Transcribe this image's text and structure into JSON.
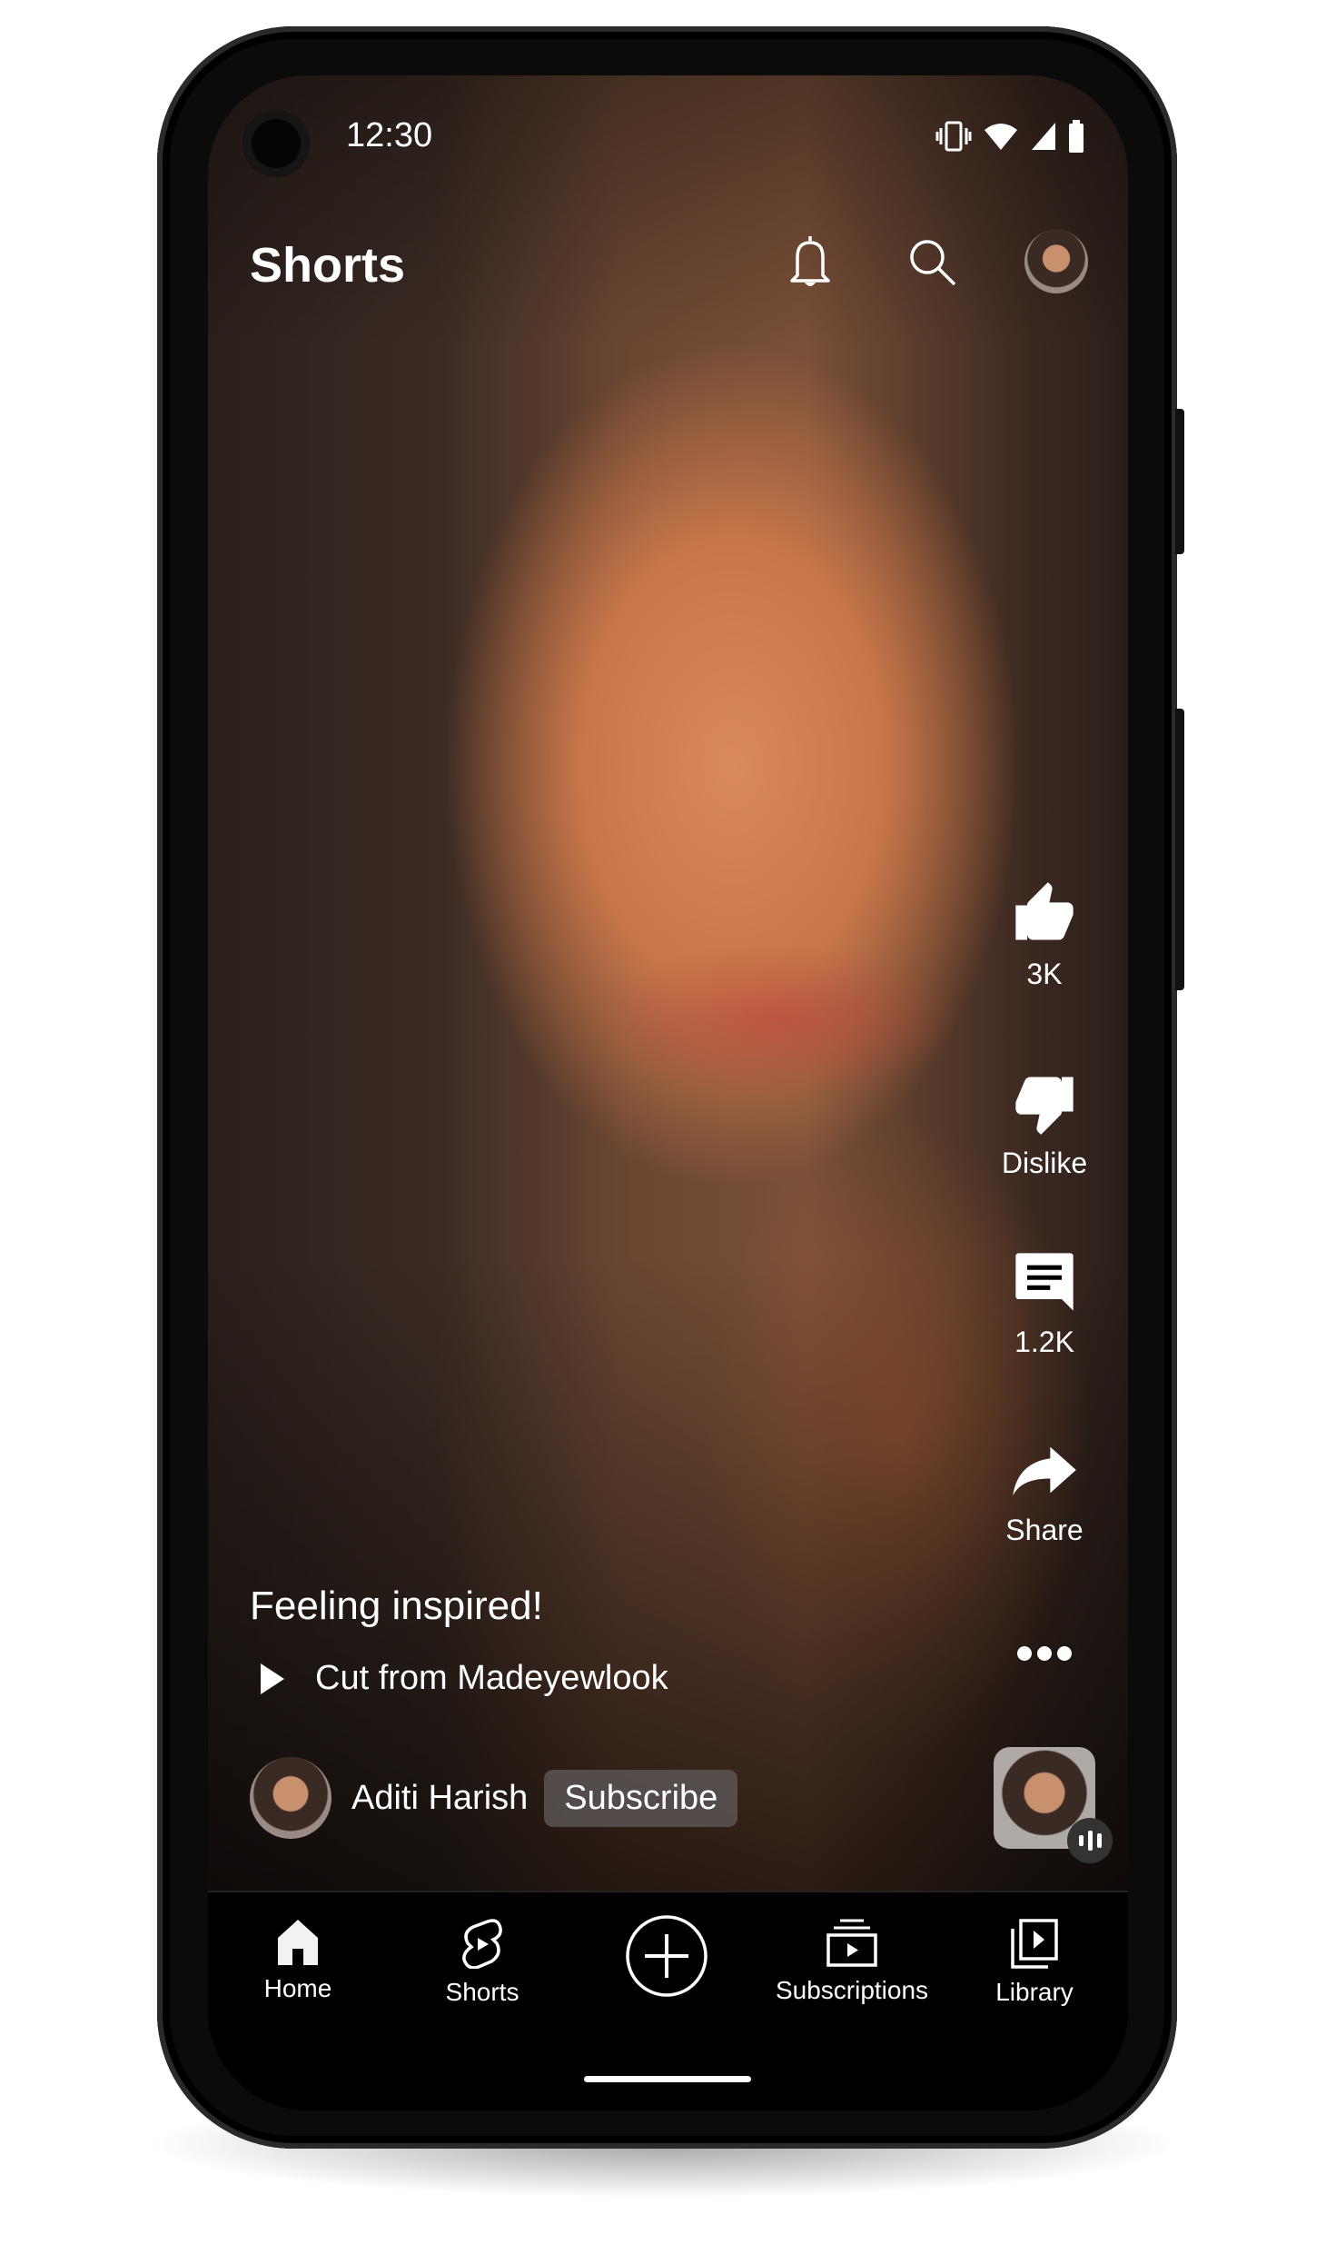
{
  "status_bar": {
    "time": "12:30",
    "icons": [
      "vibrate-icon",
      "wifi-icon",
      "signal-icon",
      "battery-icon"
    ]
  },
  "header": {
    "title": "Shorts",
    "icons": [
      "bell-icon",
      "search-icon",
      "account-avatar"
    ]
  },
  "actions": {
    "like": {
      "icon": "thumbs-up-icon",
      "label": "3K"
    },
    "dislike": {
      "icon": "thumbs-down-icon",
      "label": "Dislike"
    },
    "comments": {
      "icon": "comment-icon",
      "label": "1.2K"
    },
    "share": {
      "icon": "share-icon",
      "label": "Share"
    },
    "more": {
      "icon": "more-icon"
    }
  },
  "video": {
    "caption": "Feeling inspired!",
    "cut_from": "Cut from Madeyewlook",
    "channel": "Aditi Harish",
    "subscribe_label": "Subscribe"
  },
  "nav": {
    "items": [
      {
        "label": "Home",
        "icon": "home-icon"
      },
      {
        "label": "Shorts",
        "icon": "shorts-icon"
      },
      {
        "label": "",
        "icon": "create-icon"
      },
      {
        "label": "Subscriptions",
        "icon": "subscriptions-icon"
      },
      {
        "label": "Library",
        "icon": "library-icon"
      }
    ]
  }
}
